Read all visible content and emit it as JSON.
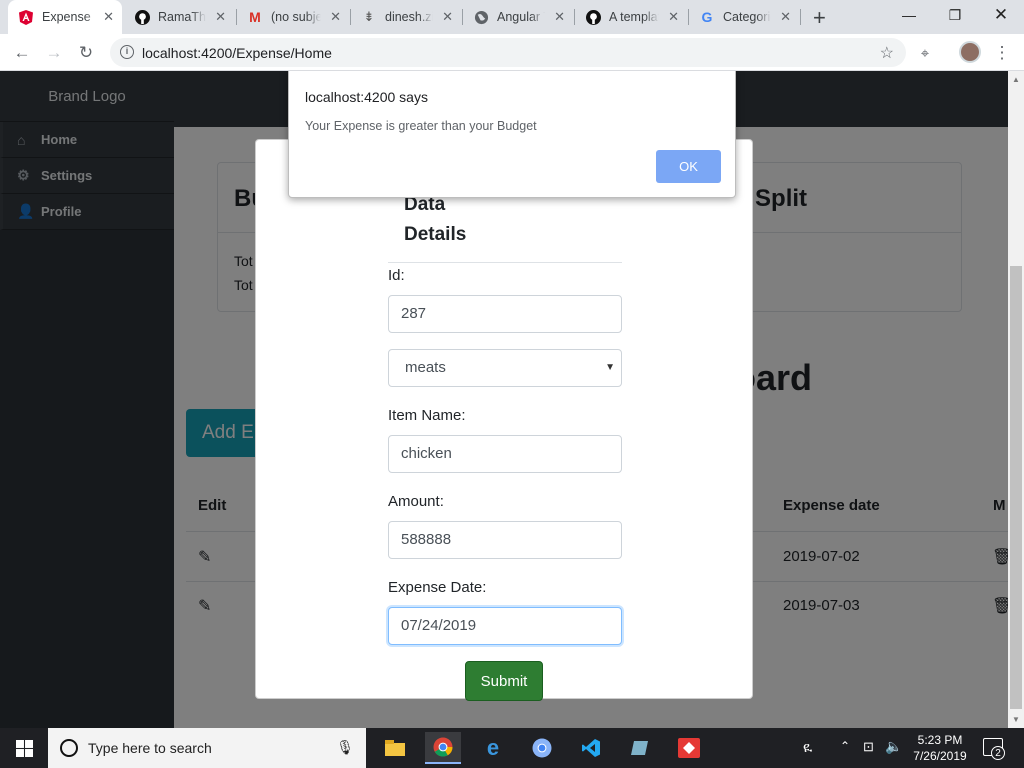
{
  "browser": {
    "tabs": [
      {
        "title": "Expense",
        "icon": "angular-icon",
        "active": true
      },
      {
        "title": "RamaTheja",
        "icon": "github-icon"
      },
      {
        "title": "(no subject)",
        "icon": "gmail-icon"
      },
      {
        "title": "dinesh.zip",
        "icon": "download-icon"
      },
      {
        "title": "Angular Tutorial",
        "icon": "globe-icon"
      },
      {
        "title": "A template",
        "icon": "github-icon"
      },
      {
        "title": "Categories",
        "icon": "google-icon"
      }
    ],
    "new_tab": "+",
    "url": "localhost:4200/Expense/Home"
  },
  "sidebar": {
    "brand": "Brand Logo",
    "items": [
      {
        "label": "Home",
        "icon": "home-icon"
      },
      {
        "label": "Settings",
        "icon": "gear-icon"
      },
      {
        "label": "Profile",
        "icon": "user-icon"
      }
    ]
  },
  "background": {
    "card_left_title": "Bu",
    "card_left_line1": "Tot",
    "card_left_line2": "Tot",
    "card_right_title": "ise Split",
    "dashboard_title": "oard",
    "add_button": "Add E",
    "table": {
      "headers": {
        "edit": "Edit",
        "date": "Expense date",
        "more": "M"
      },
      "rows": [
        {
          "date": "2019-07-02"
        },
        {
          "date": "2019-07-03"
        }
      ]
    }
  },
  "modal": {
    "title_line1": "Data",
    "title_line2": "Details",
    "id_label": "Id:",
    "id_value": "287",
    "category_value": "meats",
    "item_label": "Item Name:",
    "item_value": "chicken",
    "amount_label": "Amount:",
    "amount_value": "588888",
    "date_label": "Expense Date:",
    "date_value": "07/24/2019",
    "submit": "Submit"
  },
  "alert": {
    "title": "localhost:4200 says",
    "message": "Your Expense is greater than your Budget",
    "ok": "OK"
  },
  "taskbar": {
    "search_placeholder": "Type here to search",
    "time": "5:23 PM",
    "date": "7/26/2019",
    "notifications": "2"
  }
}
